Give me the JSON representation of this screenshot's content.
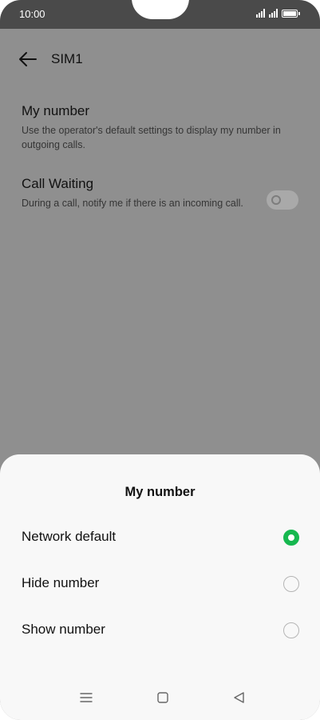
{
  "status_bar": {
    "time": "10:00",
    "icons": [
      "signal-sim1-icon",
      "signal-sim2-icon",
      "battery-icon"
    ]
  },
  "header": {
    "back_icon": "arrow-left-icon",
    "title": "SIM1"
  },
  "settings": [
    {
      "title": "My number",
      "description": "Use the operator's default settings to display my number in outgoing calls."
    },
    {
      "title": "Call Waiting",
      "description": "During a call, notify me if there is an incoming call.",
      "toggle_state": "off"
    }
  ],
  "sheet": {
    "title": "My number",
    "options": [
      {
        "label": "Network default",
        "selected": true
      },
      {
        "label": "Hide number",
        "selected": false
      },
      {
        "label": "Show number",
        "selected": false
      }
    ]
  },
  "navigation_bar": {
    "icons": [
      "menu-icon",
      "home-icon",
      "back-triangle-icon"
    ]
  },
  "colors": {
    "accent": "#16b84f",
    "scrim": "#8f8f8f",
    "sheet_background": "#f8f8f8"
  }
}
